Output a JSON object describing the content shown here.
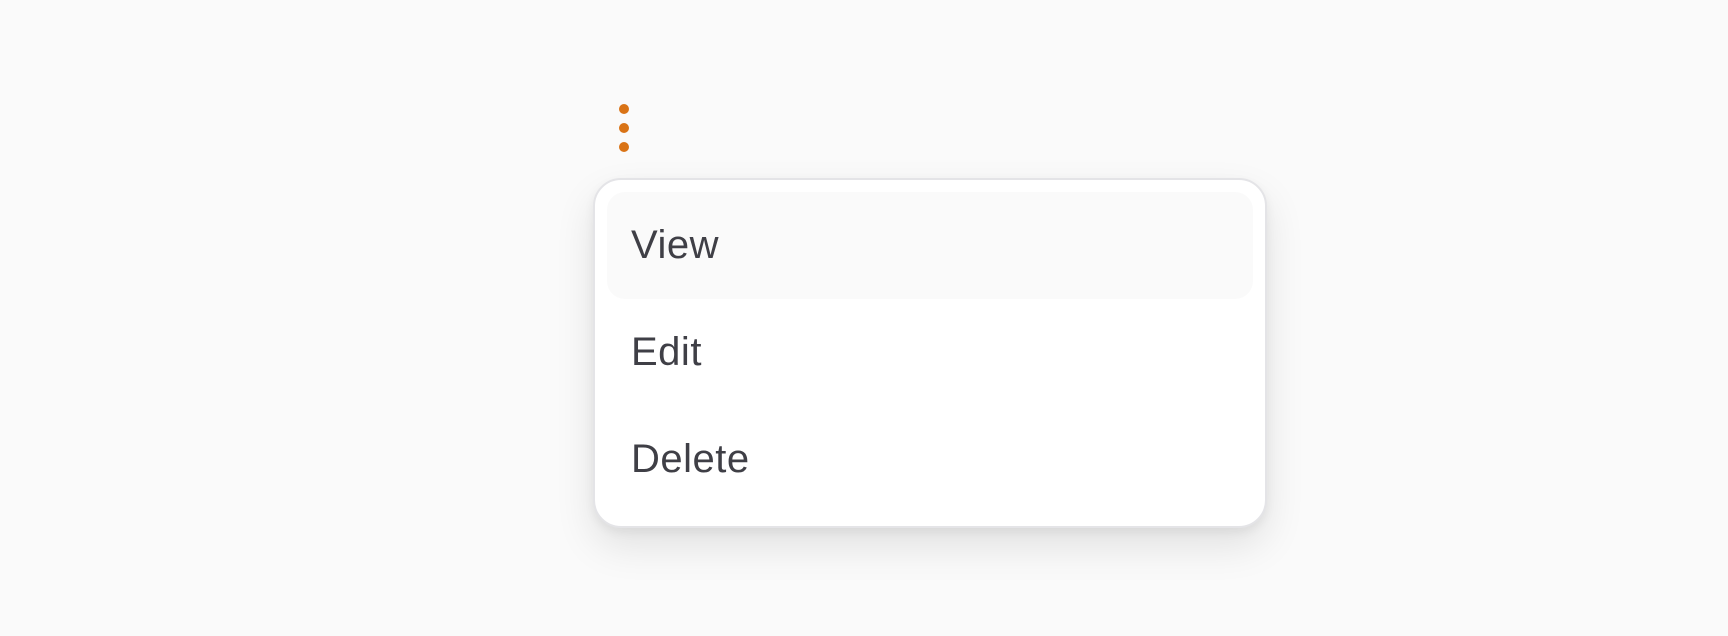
{
  "menu": {
    "trigger_icon": "vertical-ellipsis-icon",
    "accent_color": "#d97316",
    "items": [
      {
        "label": "View",
        "highlighted": true
      },
      {
        "label": "Edit",
        "highlighted": false
      },
      {
        "label": "Delete",
        "highlighted": false
      }
    ]
  }
}
